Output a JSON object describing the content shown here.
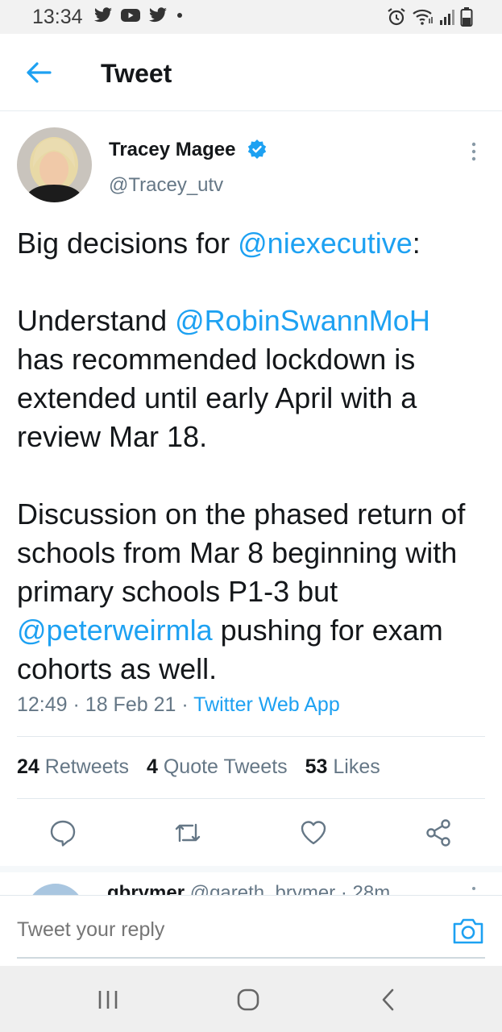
{
  "status_bar": {
    "time": "13:34",
    "left_icons": [
      "twitter-icon",
      "youtube-icon",
      "twitter-icon",
      "dot-icon"
    ],
    "right_icons": [
      "alarm-icon",
      "wifi-icon",
      "signal-icon",
      "battery-icon"
    ]
  },
  "header": {
    "title": "Tweet",
    "back_icon": "arrow-left-icon"
  },
  "tweet": {
    "author_name": "Tracey Magee",
    "author_handle": "@Tracey_utv",
    "verified": true,
    "text": {
      "line1_prefix": "Big decisions for ",
      "line1_mention": "@niexecutive",
      "line1_suffix": ":",
      "para2_prefix": "Understand ",
      "para2_mention": "@RobinSwannMoH",
      "para2_rest": "has recommended  lockdown is extended until early April with a review Mar 18.",
      "para3_text": "Discussion on the phased return of schools from Mar 8 beginning with primary schools P1-3 but ",
      "para3_mention": "@peterweirmla",
      "para3_rest": " pushing for exam cohorts as well."
    },
    "time": "12:49",
    "date": "18 Feb 21",
    "separator": "·",
    "source": "Twitter Web App",
    "stats": {
      "retweets_count": "24",
      "retweets_label": "Retweets",
      "quotes_count": "4",
      "quotes_label": "Quote Tweets",
      "likes_count": "53",
      "likes_label": "Likes"
    }
  },
  "reply_preview": {
    "name": "gbrymer",
    "handle": "@gareth_brymer",
    "separator": "·",
    "age": "28m"
  },
  "composer": {
    "placeholder": "Tweet your reply"
  },
  "colors": {
    "accent": "#1da1f2",
    "text": "#14171a",
    "secondary_text": "#657786",
    "divider": "#e1e8ed"
  }
}
